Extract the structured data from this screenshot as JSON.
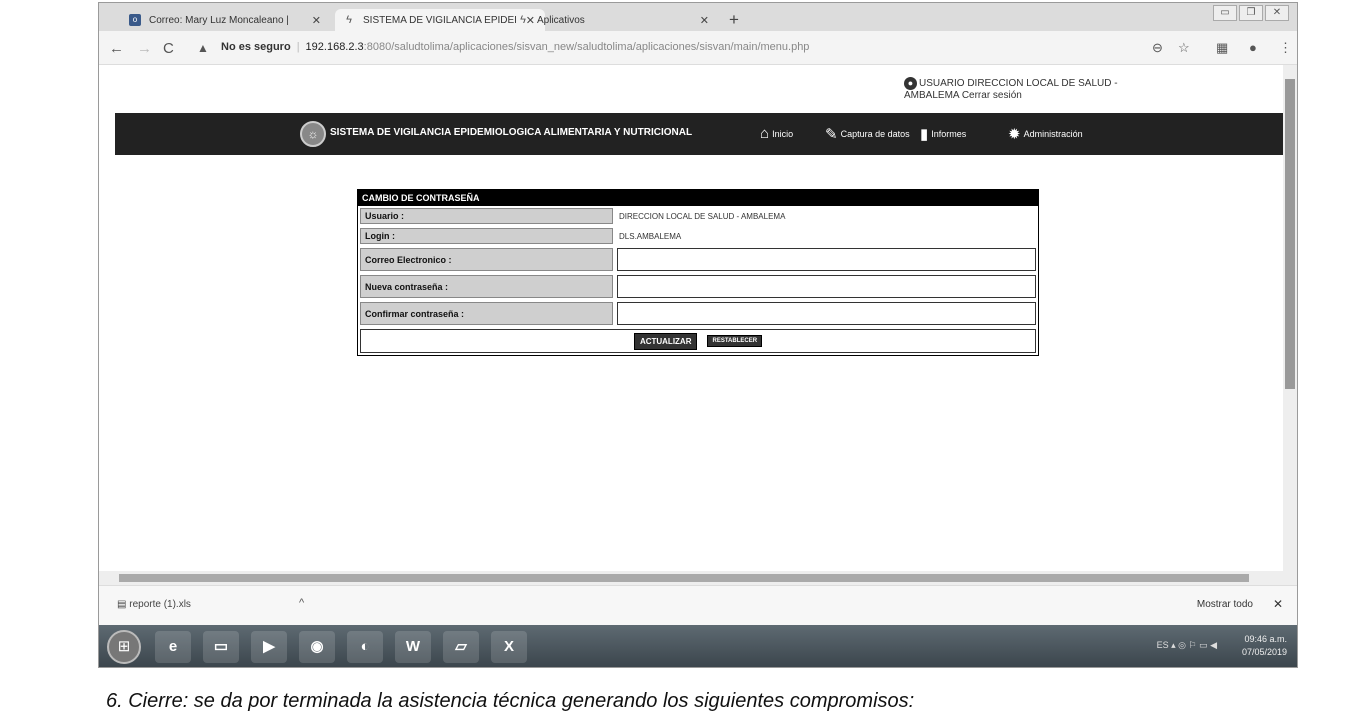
{
  "tabs": [
    {
      "label": "Correo: Mary Luz Moncaleano |"
    },
    {
      "label": "SISTEMA DE VIGILANCIA EPIDEI"
    },
    {
      "label": "Aplicativos"
    }
  ],
  "address": {
    "security": "No es seguro",
    "host": "192.168.2.3",
    "path": ":8080/saludtolima/aplicaciones/sisvan_new/saludtolima/aplicaciones/sisvan/main/menu.php"
  },
  "user": {
    "label": "USUARIO  DIRECCION LOCAL DE SALUD -",
    "line2": "AMBALEMA",
    "logout": "Cerrar sesión"
  },
  "appnav": {
    "title": "SISTEMA DE VIGILANCIA EPIDEMIOLOGICA ALIMENTARIA Y NUTRICIONAL",
    "menu": [
      "Inicio",
      "Captura de datos",
      "Informes",
      "Administración"
    ]
  },
  "form": {
    "title": "CAMBIO DE CONTRASEÑA",
    "fields": [
      {
        "label": "Usuario :",
        "value": "DIRECCION LOCAL DE SALUD - AMBALEMA"
      },
      {
        "label": "Login :",
        "value": "DLS.AMBALEMA"
      },
      {
        "label": "Correo Electronico :",
        "value": ""
      },
      {
        "label": "Nueva contraseña :",
        "value": ""
      },
      {
        "label": "Confirmar contraseña :",
        "value": ""
      }
    ],
    "submit": "ACTUALIZAR",
    "reset": "RESTABLECER"
  },
  "downloads": {
    "file": "reporte (1).xls",
    "show_all": "Mostrar todo"
  },
  "taskbar": {
    "lang": "ES",
    "time": "09:46 a.m.",
    "date": "07/05/2019"
  },
  "caption": "6.  Cierre:  se da por terminada la asistencia técnica generando los siguientes compromisos:"
}
